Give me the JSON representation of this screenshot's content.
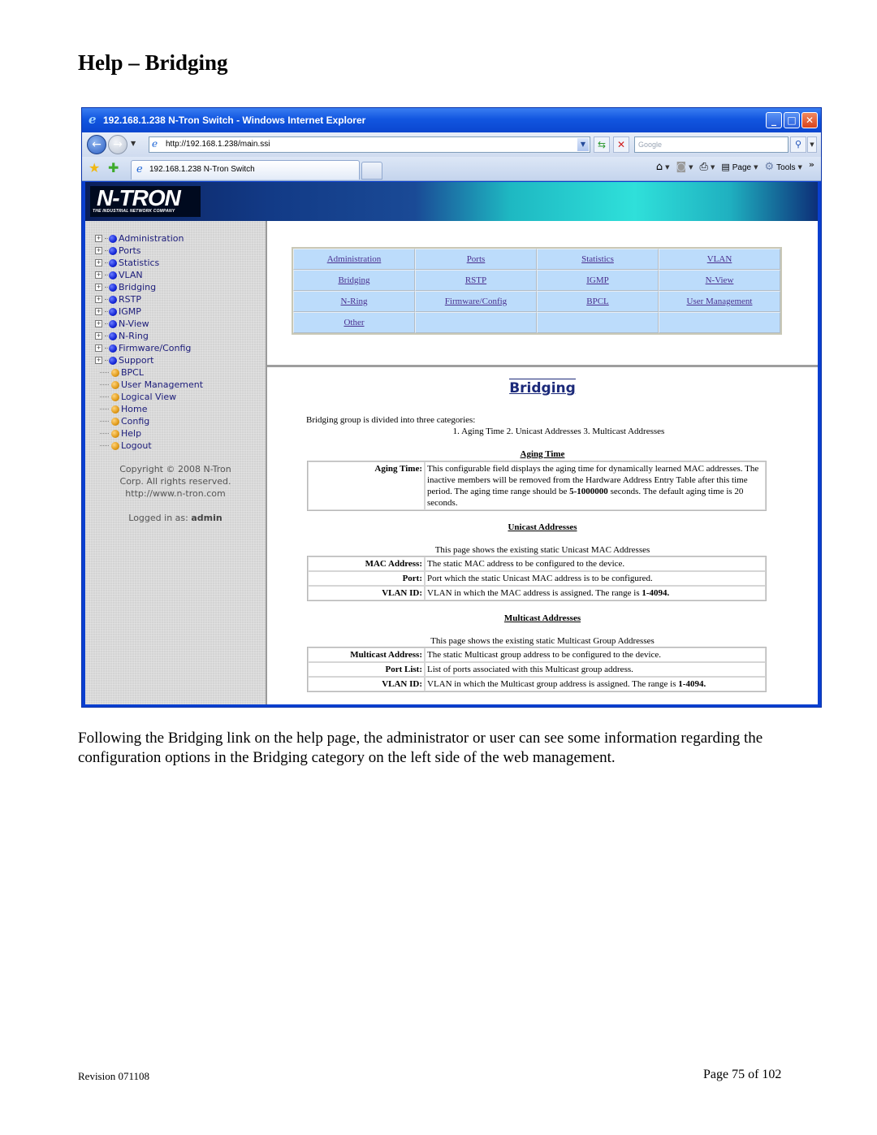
{
  "document": {
    "title": "Help – Bridging",
    "caption": "Following the Bridging link on the help page, the administrator or user can see some information regarding the configuration options in the Bridging category on the left side of the web management.",
    "footer": {
      "revision": "Revision 071108",
      "page": "Page 75 of 102"
    }
  },
  "browser": {
    "window_title": "192.168.1.238 N-Tron Switch - Windows Internet Explorer",
    "address": "http://192.168.1.238/main.ssi",
    "search_placeholder": "Google",
    "tab_title": "192.168.1.238 N-Tron Switch",
    "commands": {
      "page": "Page",
      "tools": "Tools"
    },
    "icons": {
      "app": "ie-logo-icon",
      "minimize": "minimize-icon",
      "maximize": "maximize-icon",
      "close": "close-icon",
      "back": "back-arrow-icon",
      "forward": "forward-arrow-icon",
      "refresh": "refresh-icon",
      "stop": "stop-icon",
      "search": "magnifier-icon",
      "favorites": "star-icon",
      "add_favorite": "add-favorite-icon",
      "home": "home-icon",
      "feeds": "rss-icon",
      "print": "printer-icon"
    }
  },
  "webapp": {
    "logo": {
      "name": "N-TRON",
      "tagline": "THE INDUSTRIAL NETWORK COMPANY"
    },
    "sidebar": {
      "items": [
        {
          "label": "Administration",
          "type": "folder"
        },
        {
          "label": "Ports",
          "type": "folder"
        },
        {
          "label": "Statistics",
          "type": "folder"
        },
        {
          "label": "VLAN",
          "type": "folder"
        },
        {
          "label": "Bridging",
          "type": "folder"
        },
        {
          "label": "RSTP",
          "type": "folder"
        },
        {
          "label": "IGMP",
          "type": "folder"
        },
        {
          "label": "N-View",
          "type": "folder"
        },
        {
          "label": "N-Ring",
          "type": "folder"
        },
        {
          "label": "Firmware/Config",
          "type": "folder"
        },
        {
          "label": "Support",
          "type": "folder"
        },
        {
          "label": "BPCL",
          "type": "page"
        },
        {
          "label": "User Management",
          "type": "page"
        },
        {
          "label": "Logical View",
          "type": "page"
        },
        {
          "label": "Home",
          "type": "page"
        },
        {
          "label": "Config",
          "type": "page"
        },
        {
          "label": "Help",
          "type": "page"
        },
        {
          "label": "Logout",
          "type": "page"
        }
      ],
      "copyright_lines": [
        "Copyright © 2008 N-Tron",
        "Corp. All rights reserved.",
        "http://www.n-tron.com"
      ],
      "logged_in_label": "Logged in as:",
      "logged_in_user": "admin"
    },
    "help_nav": {
      "rows": [
        [
          "Administration",
          "Ports",
          "Statistics",
          "VLAN"
        ],
        [
          "Bridging",
          "RSTP",
          "IGMP",
          "N-View"
        ],
        [
          "N-Ring",
          "Firmware/Config",
          "BPCL",
          "User Management"
        ],
        [
          "Other",
          "",
          "",
          ""
        ]
      ]
    },
    "help": {
      "title": "Bridging",
      "intro": "Bridging group is divided into three categories:",
      "categories": "1. Aging Time  2. Unicast Addresses  3. Multicast Addresses",
      "aging": {
        "heading": "Aging Time",
        "rows": [
          {
            "key": "Aging Time:",
            "pre": "This configurable field displays the aging time for dynamically learned MAC addresses. The inactive members will be removed from the Hardware Address Entry Table after this time period. The aging time range should be ",
            "bold": "5-1000000",
            "post": " seconds. The default aging time is 20 seconds."
          }
        ]
      },
      "unicast": {
        "heading": "Unicast Addresses",
        "subtitle": "This page shows the existing static Unicast MAC Addresses",
        "rows": [
          {
            "key": "MAC Address:",
            "pre": "The static MAC address to be configured to the device.",
            "bold": "",
            "post": ""
          },
          {
            "key": "Port:",
            "pre": "Port which the static Unicast MAC address is to be configured.",
            "bold": "",
            "post": ""
          },
          {
            "key": "VLAN ID:",
            "pre": "VLAN in which the MAC address is assigned. The range is ",
            "bold": "1-4094.",
            "post": ""
          }
        ]
      },
      "multicast": {
        "heading": "Multicast Addresses",
        "subtitle": "This page shows the existing static Multicast Group Addresses",
        "rows": [
          {
            "key": "Multicast Address:",
            "pre": "The static Multicast group address to be configured to the device.",
            "bold": "",
            "post": ""
          },
          {
            "key": "Port List:",
            "pre": "List of ports associated with this Multicast group address.",
            "bold": "",
            "post": ""
          },
          {
            "key": "VLAN ID:",
            "pre": "VLAN in which the Multicast group address is assigned. The range is ",
            "bold": "1-4094.",
            "post": ""
          }
        ]
      }
    }
  },
  "colors": {
    "titlebar": "#1256e0",
    "nav_table_bg": "#bcdcfb",
    "link": "#4a2f8f",
    "sidebar_bg": "#d4d4d4",
    "sidebar_text": "#1c1c7a",
    "help_title": "#1c2a7a"
  }
}
